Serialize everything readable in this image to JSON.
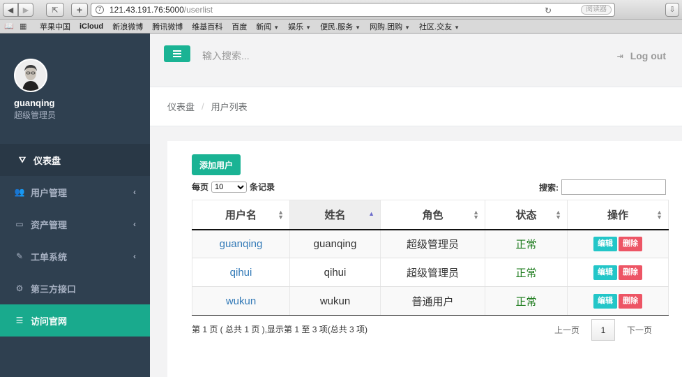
{
  "browser": {
    "url_host": "121.43.191.76:5000",
    "url_path": "/userlist",
    "reader_label": "阅读器",
    "bookmarks": [
      {
        "label": "苹果中国",
        "menu": false,
        "bold": false
      },
      {
        "label": "iCloud",
        "menu": false,
        "bold": true
      },
      {
        "label": "新浪微博",
        "menu": false,
        "bold": false
      },
      {
        "label": "腾讯微博",
        "menu": false,
        "bold": false
      },
      {
        "label": "维基百科",
        "menu": false,
        "bold": false
      },
      {
        "label": "百度",
        "menu": false,
        "bold": false
      },
      {
        "label": "新闻",
        "menu": true,
        "bold": false
      },
      {
        "label": "娱乐",
        "menu": true,
        "bold": false
      },
      {
        "label": "便民.服务",
        "menu": true,
        "bold": false
      },
      {
        "label": "网购.团购",
        "menu": true,
        "bold": false
      },
      {
        "label": "社区.交友",
        "menu": true,
        "bold": false
      }
    ]
  },
  "sidebar": {
    "profile": {
      "name": "guanqing",
      "role": "超级管理员"
    },
    "items": [
      {
        "label": "仪表盘",
        "icon": "dashboard-icon",
        "arrow": false
      },
      {
        "label": "用户管理",
        "icon": "users-icon",
        "arrow": true
      },
      {
        "label": "资产管理",
        "icon": "inbox-icon",
        "arrow": true
      },
      {
        "label": "工单系统",
        "icon": "edit-icon",
        "arrow": true
      },
      {
        "label": "第三方接口",
        "icon": "cogs-icon",
        "arrow": false
      },
      {
        "label": "访问官网",
        "icon": "database-icon",
        "arrow": false
      }
    ]
  },
  "header": {
    "search_placeholder": "输入搜索...",
    "logout_label": "Log out"
  },
  "breadcrumb": {
    "items": [
      "仪表盘",
      "用户列表"
    ],
    "separator": "/"
  },
  "main": {
    "add_button": "添加用户",
    "per_page_prefix": "每页",
    "per_page_value": "10",
    "per_page_suffix": "条记录",
    "search_label": "搜索:",
    "columns": [
      "用户名",
      "姓名",
      "角色",
      "状态",
      "操作"
    ],
    "rows": [
      {
        "username": "guanqing",
        "name": "guanqing",
        "role": "超级管理员",
        "status": "正常",
        "edit": "编辑",
        "delete": "删除"
      },
      {
        "username": "qihui",
        "name": "qihui",
        "role": "超级管理员",
        "status": "正常",
        "edit": "编辑",
        "delete": "删除"
      },
      {
        "username": "wukun",
        "name": "wukun",
        "role": "普通用户",
        "status": "正常",
        "edit": "编辑",
        "delete": "删除"
      }
    ],
    "info": "第 1 页 ( 总共 1 页 ),显示第 1 至 3 项(总共 3 项)",
    "pager": {
      "prev": "上一页",
      "current": "1",
      "next": "下一页"
    }
  },
  "colors": {
    "accent": "#1ab394",
    "sidebar": "#2f4050",
    "edit": "#23c6c8",
    "delete": "#ed5565"
  }
}
